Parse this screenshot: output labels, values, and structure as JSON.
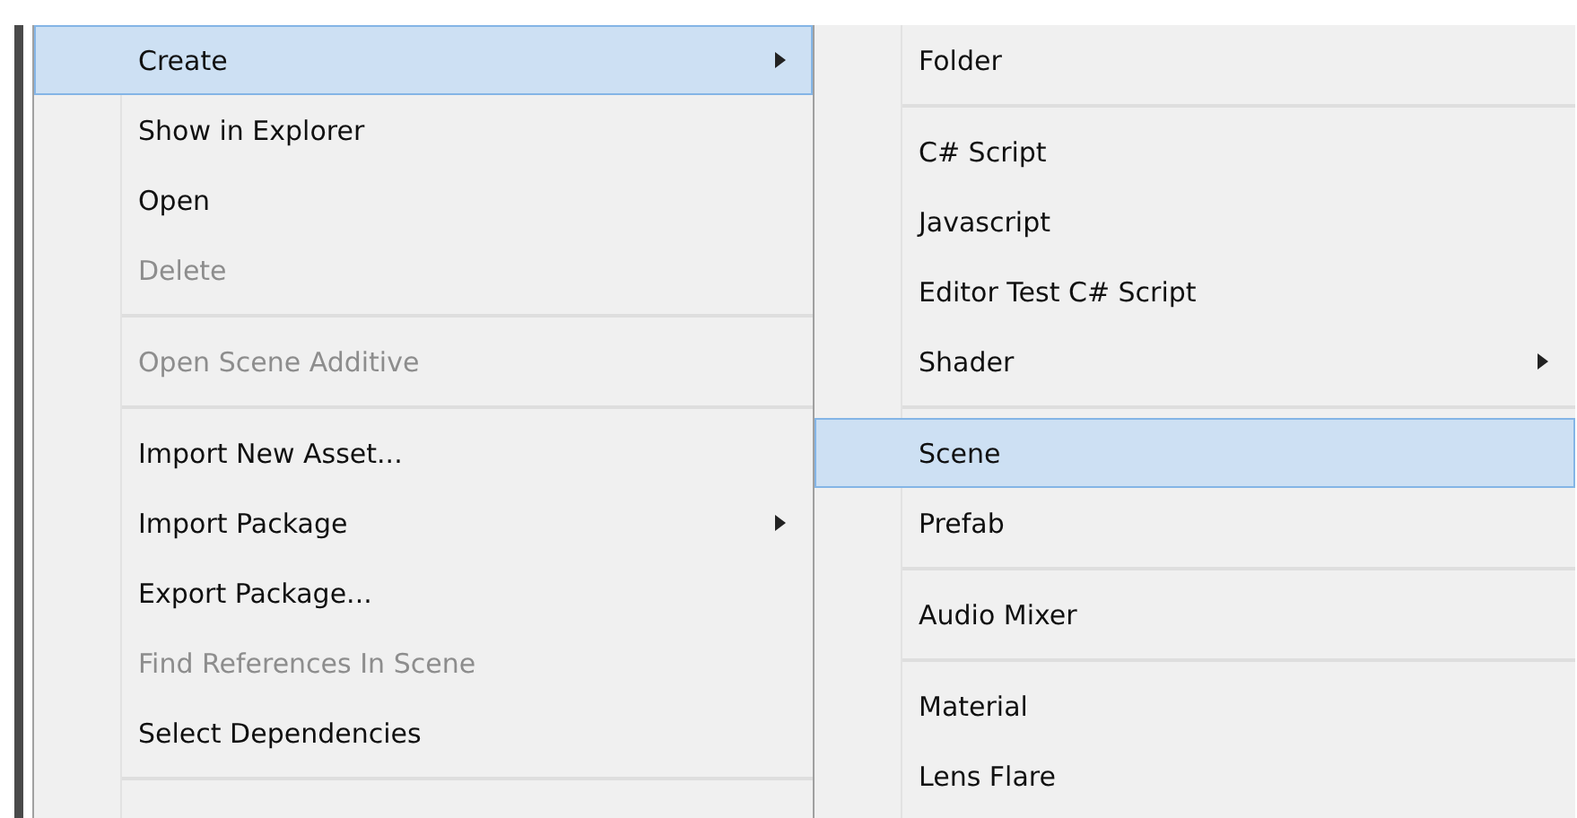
{
  "context_menu": {
    "items": [
      {
        "kind": "item",
        "label": "Create",
        "selected": true,
        "disabled": false,
        "submenu": true
      },
      {
        "kind": "item",
        "label": "Show in Explorer",
        "selected": false,
        "disabled": false,
        "submenu": false
      },
      {
        "kind": "item",
        "label": "Open",
        "selected": false,
        "disabled": false,
        "submenu": false
      },
      {
        "kind": "item",
        "label": "Delete",
        "selected": false,
        "disabled": true,
        "submenu": false
      },
      {
        "kind": "separator"
      },
      {
        "kind": "item",
        "label": "Open Scene Additive",
        "selected": false,
        "disabled": true,
        "submenu": false
      },
      {
        "kind": "separator"
      },
      {
        "kind": "item",
        "label": "Import New Asset...",
        "selected": false,
        "disabled": false,
        "submenu": false
      },
      {
        "kind": "item",
        "label": "Import Package",
        "selected": false,
        "disabled": false,
        "submenu": true
      },
      {
        "kind": "item",
        "label": "Export Package...",
        "selected": false,
        "disabled": false,
        "submenu": false
      },
      {
        "kind": "item",
        "label": "Find References In Scene",
        "selected": false,
        "disabled": true,
        "submenu": false
      },
      {
        "kind": "item",
        "label": "Select Dependencies",
        "selected": false,
        "disabled": false,
        "submenu": false
      },
      {
        "kind": "separator"
      }
    ]
  },
  "create_submenu": {
    "items": [
      {
        "kind": "item",
        "label": "Folder",
        "selected": false,
        "disabled": false,
        "submenu": false
      },
      {
        "kind": "separator"
      },
      {
        "kind": "item",
        "label": "C# Script",
        "selected": false,
        "disabled": false,
        "submenu": false
      },
      {
        "kind": "item",
        "label": "Javascript",
        "selected": false,
        "disabled": false,
        "submenu": false
      },
      {
        "kind": "item",
        "label": "Editor Test C# Script",
        "selected": false,
        "disabled": false,
        "submenu": false
      },
      {
        "kind": "item",
        "label": "Shader",
        "selected": false,
        "disabled": false,
        "submenu": true
      },
      {
        "kind": "separator"
      },
      {
        "kind": "item",
        "label": "Scene",
        "selected": true,
        "disabled": false,
        "submenu": false
      },
      {
        "kind": "item",
        "label": "Prefab",
        "selected": false,
        "disabled": false,
        "submenu": false
      },
      {
        "kind": "separator"
      },
      {
        "kind": "item",
        "label": "Audio Mixer",
        "selected": false,
        "disabled": false,
        "submenu": false
      },
      {
        "kind": "separator"
      },
      {
        "kind": "item",
        "label": "Material",
        "selected": false,
        "disabled": false,
        "submenu": false
      },
      {
        "kind": "item",
        "label": "Lens Flare",
        "selected": false,
        "disabled": false,
        "submenu": false
      }
    ]
  }
}
